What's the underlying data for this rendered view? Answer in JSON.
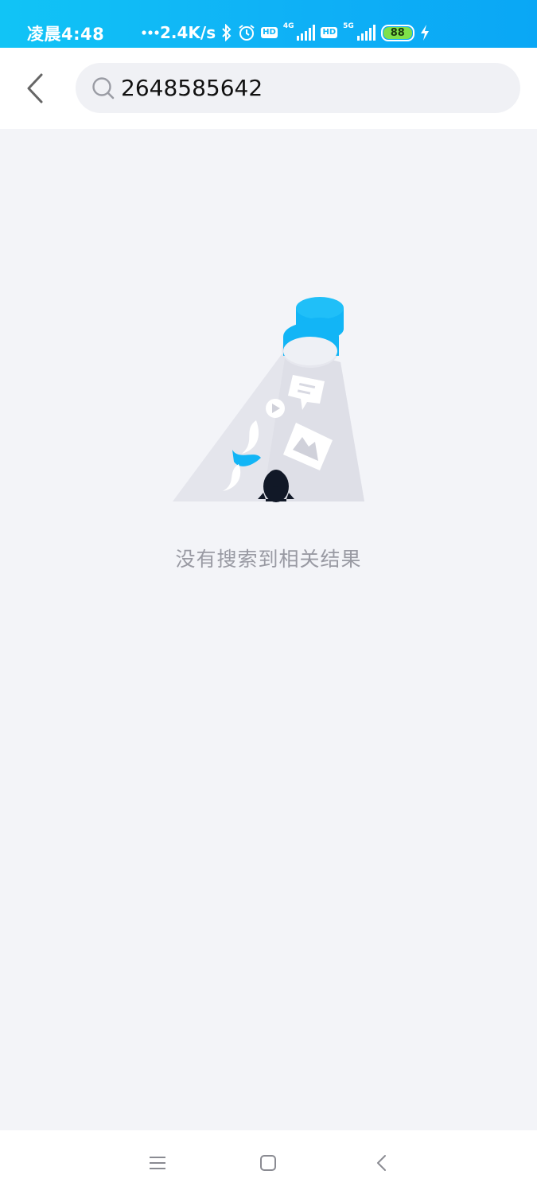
{
  "status_bar": {
    "time": "凌晨4:48",
    "network_speed": "2.4K/s",
    "hd_label": "HD",
    "signal_1_tech": "4G",
    "signal_2_tech": "5G",
    "battery_level": "88",
    "icons": [
      "dots-icon",
      "bluetooth-icon",
      "alarm-icon",
      "hd-icon",
      "signal-icon",
      "hd-icon",
      "signal-icon",
      "battery-icon",
      "charging-icon"
    ]
  },
  "search": {
    "value": "2648585642"
  },
  "empty_state": {
    "message": "没有搜索到相关结果",
    "illustration": "flashlight-search-illustration"
  },
  "nav_bar": {
    "icons": [
      "menu-icon",
      "home-icon",
      "back-icon"
    ]
  },
  "colors": {
    "accent": "#12b5f6",
    "background": "#f3f4f8",
    "empty_text": "#999aa3"
  }
}
